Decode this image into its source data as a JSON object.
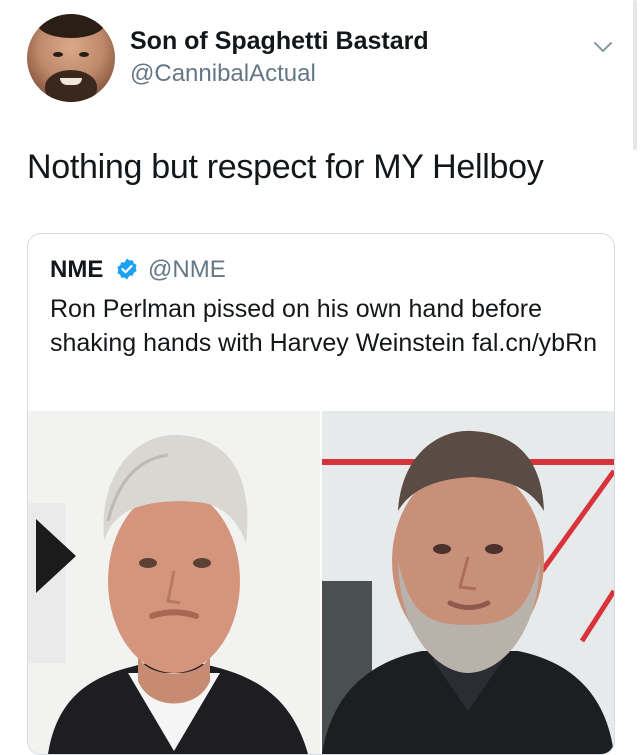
{
  "tweet": {
    "display_name": "Son of Spaghetti Bastard",
    "handle": "@CannibalActual",
    "text": "Nothing but respect for MY Hellboy"
  },
  "quoted_tweet": {
    "name": "NME",
    "handle": "@NME",
    "text": "Ron Perlman pissed on his own hand before shaking hands with Harvey Weinstein fal.cn/ybRn",
    "verified": true
  },
  "icons": {
    "menu": "chevron-down-icon",
    "verified": "verified-badge-icon"
  },
  "colors": {
    "text": "#14171a",
    "secondary": "#657786",
    "verified_blue": "#1da1f2",
    "border": "#d4dbe1"
  }
}
